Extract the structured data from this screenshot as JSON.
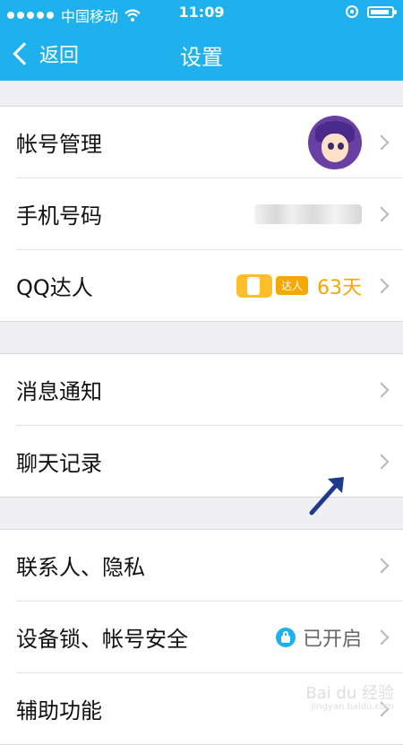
{
  "status_bar": {
    "carrier": "中国移动",
    "time": "11:09"
  },
  "nav": {
    "back_label": "返回",
    "title": "设置"
  },
  "groups": [
    {
      "items": [
        {
          "label": "帐号管理"
        },
        {
          "label": "手机号码"
        },
        {
          "label": "QQ达人",
          "badge_tag": "达人",
          "badge_days": "63天"
        }
      ]
    },
    {
      "items": [
        {
          "label": "消息通知"
        },
        {
          "label": "聊天记录"
        }
      ]
    },
    {
      "items": [
        {
          "label": "联系人、隐私"
        },
        {
          "label": "设备锁、帐号安全",
          "status_text": "已开启"
        },
        {
          "label": "辅助功能"
        }
      ]
    }
  ],
  "colors": {
    "brand_blue": "#1fb1ee",
    "badge_orange": "#f5a900",
    "annotation_arrow": "#1f3a8c"
  },
  "watermark": {
    "text": "Bai du 经验",
    "sub": "jingyan.baidu.com"
  }
}
